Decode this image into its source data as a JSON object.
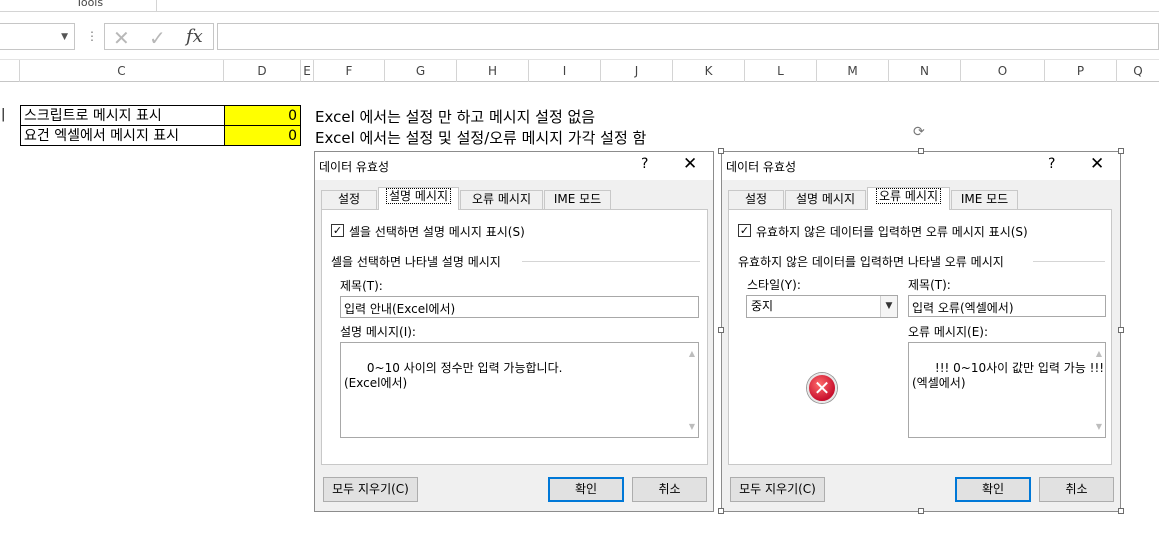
{
  "ribbon": {
    "group_label": "Tools"
  },
  "formula_bar": {
    "name_box": "",
    "dots": "⋮",
    "cancel_glyph": "✕",
    "enter_glyph": "✓",
    "fx_glyph": "fx",
    "formula": ""
  },
  "columns": [
    "C",
    "D",
    "E",
    "F",
    "G",
    "H",
    "I",
    "J",
    "K",
    "L",
    "M",
    "N",
    "O",
    "P",
    "Q"
  ],
  "cells": {
    "row1_c": "스크립트로 메시지 표시",
    "row1_d": "0",
    "row2_c": "요건 엑셀에서 메시지 표시",
    "row2_d": "0",
    "row1_note": "Excel 에서는 설정 만 하고 메시지 설정 없음",
    "row2_note": "Excel 에서는 설정 및 설정/오류 메시지 가각 설정 함",
    "row1_b_fragment": "|"
  },
  "dialog_left": {
    "title": "데이터 유효성",
    "help": "?",
    "close": "✕",
    "tabs": [
      "설정",
      "설명 메시지",
      "오류 메시지",
      "IME 모드"
    ],
    "active_tab": "설명 메시지",
    "checkbox_label": "셀을 선택하면 설명 메시지 표시(S)",
    "checkbox_checked": "✓",
    "group_label": "셀을 선택하면 나타낼 설명 메시지",
    "title_label": "제목(T):",
    "title_value": "입력 안내(Excel에서)",
    "message_label": "설명 메시지(I):",
    "message_value": "0~10 사이의 정수만 입력 가능합니다.\n(Excel에서)",
    "clear_button": "모두 지우기(C)",
    "ok_button": "확인",
    "cancel_button": "취소"
  },
  "dialog_right": {
    "title": "데이터 유효성",
    "help": "?",
    "close": "✕",
    "tabs": [
      "설정",
      "설명 메시지",
      "오류 메시지",
      "IME 모드"
    ],
    "active_tab": "오류 메시지",
    "checkbox_label": "유효하지 않은 데이터를 입력하면 오류 메시지 표시(S)",
    "checkbox_checked": "✓",
    "group_label": "유효하지 않은 데이터를 입력하면 나타낼 오류 메시지",
    "style_label": "스타일(Y):",
    "style_value": "중지",
    "title_label": "제목(T):",
    "title_value": "입력 오류(엑셀에서)",
    "message_label": "오류 메시지(E):",
    "message_value": "!!! 0~10사이 값만 입력 가능 !!!\n(엑셀에서)",
    "error_glyph": "✕",
    "clear_button": "모두 지우기(C)",
    "ok_button": "확인",
    "cancel_button": "취소"
  },
  "colors": {
    "cell_highlight": "#ffff00",
    "default_button_border": "#0078d7",
    "error_icon": "#c8102e"
  }
}
